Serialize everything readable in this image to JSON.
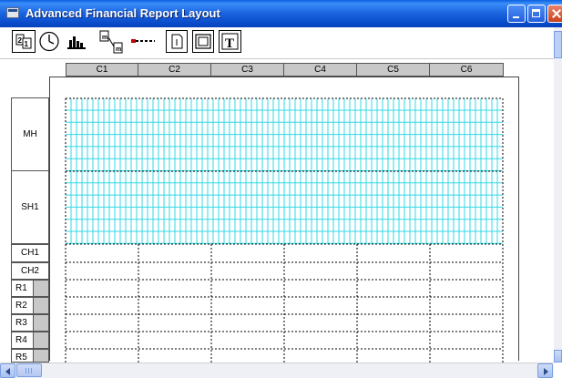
{
  "window": {
    "title": "Advanced Financial Report Layout"
  },
  "toolbar": {
    "tools": [
      {
        "icon": "fields-icon"
      },
      {
        "icon": "clock-icon"
      },
      {
        "icon": "chart-icon"
      },
      {
        "icon": "copy-icon"
      },
      {
        "icon": "line-icon"
      },
      {
        "icon": "page-icon"
      },
      {
        "icon": "frame-icon"
      },
      {
        "icon": "text-icon"
      }
    ]
  },
  "columns": [
    "C1",
    "C2",
    "C3",
    "C4",
    "C5",
    "C6"
  ],
  "rows": {
    "mh": "MH",
    "sh1": "SH1",
    "ch1": "CH1",
    "ch2": "CH2",
    "r1": "R1",
    "r2": "R2",
    "r3": "R3",
    "r4": "R4",
    "r5": "R5"
  },
  "colors": {
    "grid": "#33d8e6",
    "header_grey": "#c8c8c8",
    "title_blue": "#0a5fe0"
  }
}
